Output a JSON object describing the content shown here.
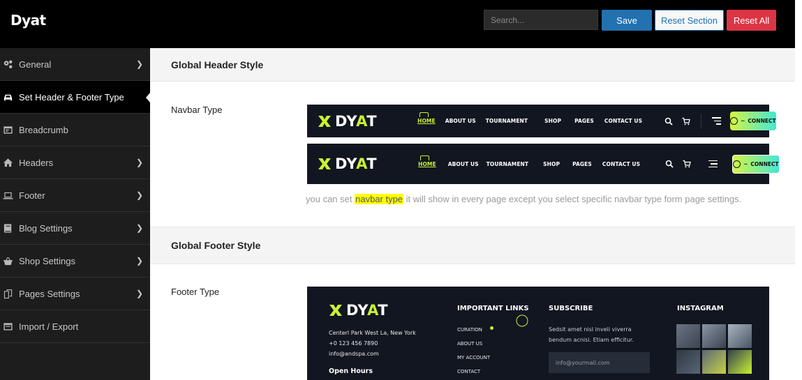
{
  "app": {
    "title": "Dyat"
  },
  "toolbar": {
    "search_placeholder": "Search...",
    "save_label": "Save",
    "reset_section_label": "Reset Section",
    "reset_all_label": "Reset All"
  },
  "sidebar": {
    "items": [
      {
        "label": "General",
        "icon": "gears-icon",
        "has_arrow": true
      },
      {
        "label": "Set Header & Footer Type",
        "icon": "car-icon",
        "active": true
      },
      {
        "label": "Breadcrumb",
        "icon": "window-icon",
        "has_arrow": false
      },
      {
        "label": "Headers",
        "icon": "home-icon",
        "has_arrow": true
      },
      {
        "label": "Footer",
        "icon": "laptop-icon",
        "has_arrow": true
      },
      {
        "label": "Blog Settings",
        "icon": "book-icon",
        "has_arrow": true
      },
      {
        "label": "Shop Settings",
        "icon": "basket-icon",
        "has_arrow": true
      },
      {
        "label": "Pages Settings",
        "icon": "copy-icon",
        "has_arrow": true
      },
      {
        "label": "Import / Export",
        "icon": "window-icon",
        "has_arrow": false
      }
    ]
  },
  "main": {
    "header_section_title": "Global Header Style",
    "navbar_type_label": "Navbar Type",
    "hint": {
      "before": "you can set ",
      "highlight": "navbar type",
      "after": " it will show in every page except you select specific navbar type form page settings."
    },
    "footer_section_title": "Global Footer Style",
    "footer_type_label": "Footer Type"
  },
  "navbar_preview": {
    "logo_text_start": "DY",
    "logo_text_accent": "A",
    "logo_text_end": "T",
    "menu": [
      "HOME",
      "ABOUT US",
      "TOURNAMENT",
      "SHOP",
      "PAGES",
      "CONTACT US"
    ],
    "connect_label": "CONNECT",
    "accent_color": "#c9f232"
  },
  "footer_preview": {
    "logo_text_start": "DY",
    "logo_text_accent": "A",
    "logo_text_end": "T",
    "address": "Centerl Park West La, New York",
    "phone": "+0 123 456 7890",
    "email": "info@andspa.com",
    "hours_title": "Open Hours",
    "links_title": "IMPORTANT LINKS",
    "links": [
      "CURATION",
      "ABOUT US",
      "MY ACCOUNT",
      "CONTACT"
    ],
    "subscribe_title": "SUBSCRIBE",
    "subscribe_text_1": "Sedsit amet nisl inveli viverra",
    "subscribe_text_2": "bendum acnisi. Etiam efficitur.",
    "subscribe_placeholder": "info@yourmail.com",
    "instagram_title": "INSTAGRAM"
  }
}
